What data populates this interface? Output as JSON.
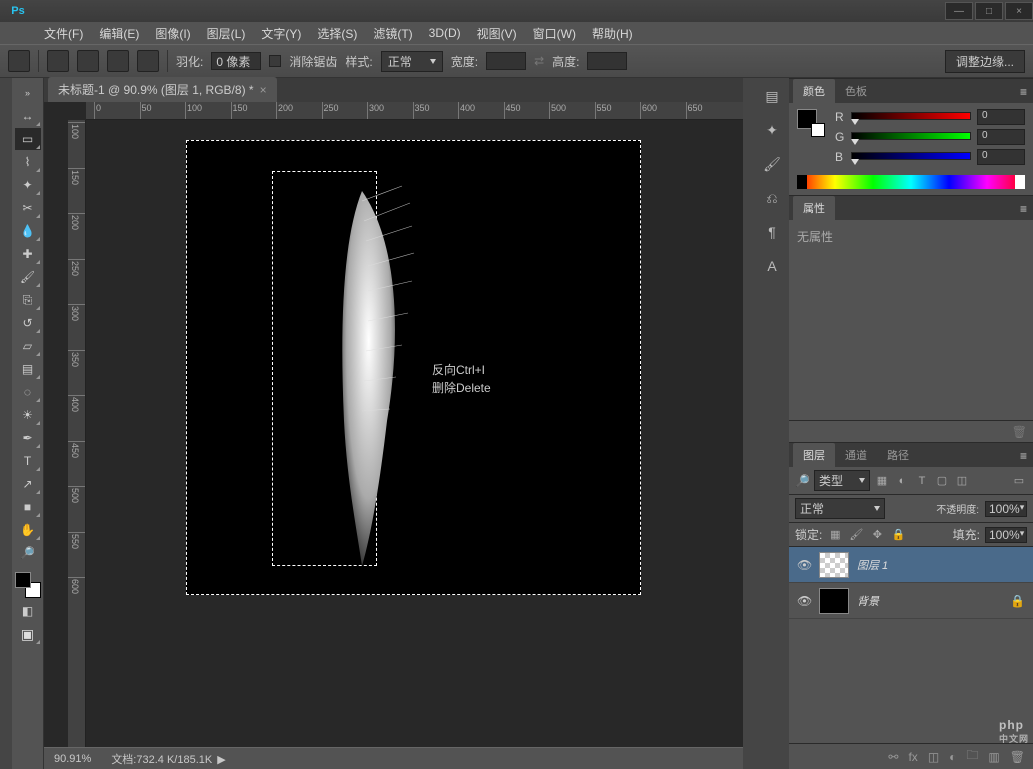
{
  "app_logo": "Ps",
  "window_buttons": {
    "min": "—",
    "max": "□",
    "close": "×"
  },
  "menu": [
    "文件(F)",
    "编辑(E)",
    "图像(I)",
    "图层(L)",
    "文字(Y)",
    "选择(S)",
    "滤镜(T)",
    "3D(D)",
    "视图(V)",
    "窗口(W)",
    "帮助(H)"
  ],
  "options": {
    "feather_label": "羽化:",
    "feather_value": "0 像素",
    "antialias": "消除锯齿",
    "style_label": "样式:",
    "style_value": "正常",
    "width_label": "宽度:",
    "height_label": "高度:",
    "refine": "调整边缘..."
  },
  "document": {
    "tab_title": "未标题-1 @ 90.9% (图层 1, RGB/8) *"
  },
  "ruler_marks_h": [
    0,
    50,
    100,
    150,
    200,
    250,
    300,
    350,
    400,
    450,
    500,
    550,
    600,
    650
  ],
  "ruler_marks_v": [
    100,
    150,
    200,
    250,
    300,
    350,
    400,
    450,
    500,
    550,
    600
  ],
  "annotation": {
    "line1": "反向Ctrl+I",
    "line2": "删除Delete"
  },
  "status": {
    "zoom": "90.91%",
    "doc_label": "文档:",
    "doc_value": "732.4 K/185.1K"
  },
  "panels": {
    "color": {
      "tab1": "颜色",
      "tab2": "色板",
      "r_label": "R",
      "g_label": "G",
      "b_label": "B",
      "r_val": "0",
      "g_val": "0",
      "b_val": "0"
    },
    "properties": {
      "tab": "属性",
      "empty": "无属性"
    },
    "layers": {
      "tab1": "图层",
      "tab2": "通道",
      "tab3": "路径",
      "filter_label": "类型",
      "blend_mode": "正常",
      "opacity_label": "不透明度:",
      "opacity_val": "100%",
      "lock_label": "锁定:",
      "fill_label": "填充:",
      "fill_val": "100%",
      "layer1": "图层 1",
      "background": "背景"
    }
  },
  "watermark": {
    "brand": "php",
    "sub": "中文网"
  },
  "icons": {
    "search": "🔍",
    "move": "↔",
    "marquee": "▭",
    "lasso": "⌇",
    "wand": "✦",
    "crop": "✂",
    "eyedrop": "💧",
    "heal": "✚",
    "brush": "🖌",
    "stamp": "⎘",
    "history": "↺",
    "eraser": "▱",
    "gradient": "▤",
    "blur": "◌",
    "dodge": "☀",
    "pen": "✒",
    "type": "T",
    "path": "↗",
    "shape": "■",
    "hand": "✋",
    "zoom": "🔎",
    "rgb": "◧",
    "ruler": "📏",
    "note": "📝",
    "char": "A"
  }
}
